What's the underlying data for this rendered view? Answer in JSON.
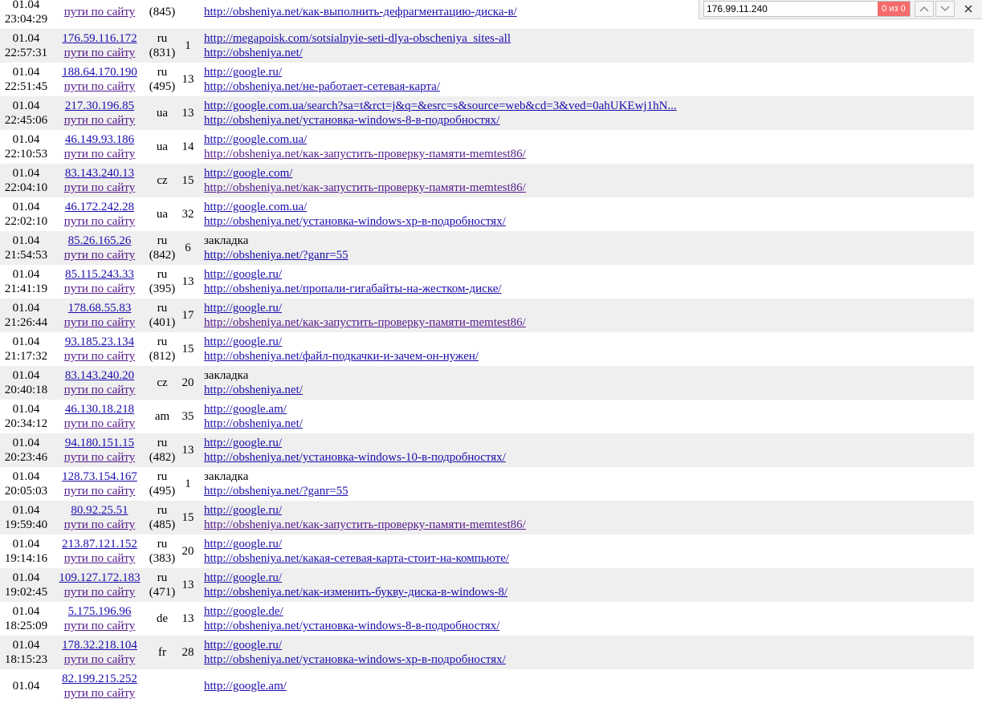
{
  "findbar": {
    "query": "176.99.11.240",
    "match_count": "0 из 0",
    "prev_icon": "chevron-up-icon",
    "next_icon": "chevron-down-icon",
    "close_icon": "close-icon",
    "count_color": "#f56b6b"
  },
  "path_label": "пути по сайту",
  "rows": [
    {
      "date": "01.04",
      "time": "23:04:29",
      "ip": "",
      "cc": "",
      "visits": "(845)",
      "n": "",
      "ref": "",
      "ref_link": false,
      "page": "http://obsheniya.net/как-выполнить-дефрагментацию-диска-в/"
    },
    {
      "date": "01.04",
      "time": "22:57:31",
      "ip": "176.59.116.172",
      "cc": "ru",
      "visits": "(831)",
      "n": "1",
      "ref": "http://megapoisk.com/sotsialnyie-seti-dlya-obscheniya_sites-all",
      "ref_link": true,
      "page": "http://obsheniya.net/"
    },
    {
      "date": "01.04",
      "time": "22:51:45",
      "ip": "188.64.170.190",
      "cc": "ru",
      "visits": "(495)",
      "n": "13",
      "ref": "http://google.ru/",
      "ref_link": true,
      "page": "http://obsheniya.net/не-работает-сетевая-карта/"
    },
    {
      "date": "01.04",
      "time": "22:45:06",
      "ip": "217.30.196.85",
      "cc": "ua",
      "visits": "",
      "n": "13",
      "ref": "http://google.com.ua/search?sa=t&rct=j&q=&esrc=s&source=web&cd=3&ved=0ahUKEwj1hN...",
      "ref_link": true,
      "page": "http://obsheniya.net/установка-windows-8-в-подробностях/"
    },
    {
      "date": "01.04",
      "time": "22:10:53",
      "ip": "46.149.93.186",
      "cc": "ua",
      "visits": "",
      "n": "14",
      "ref": "http://google.com.ua/",
      "ref_link": true,
      "page": "http://obsheniya.net/как-запустить-проверку-памяти-memtest86/"
    },
    {
      "date": "01.04",
      "time": "22:04:10",
      "ip": "83.143.240.13",
      "cc": "cz",
      "visits": "",
      "n": "15",
      "ref": "http://google.com/",
      "ref_link": true,
      "page": "http://obsheniya.net/как-запустить-проверку-памяти-memtest86/"
    },
    {
      "date": "01.04",
      "time": "22:02:10",
      "ip": "46.172.242.28",
      "cc": "ua",
      "visits": "",
      "n": "32",
      "ref": "http://google.com.ua/",
      "ref_link": true,
      "page": "http://obsheniya.net/установка-windows-xp-в-подробностях/"
    },
    {
      "date": "01.04",
      "time": "21:54:53",
      "ip": "85.26.165.26",
      "cc": "ru",
      "visits": "(842)",
      "n": "6",
      "ref": "закладка",
      "ref_link": false,
      "page": "http://obsheniya.net/?ganr=55"
    },
    {
      "date": "01.04",
      "time": "21:41:19",
      "ip": "85.115.243.33",
      "cc": "ru",
      "visits": "(395)",
      "n": "13",
      "ref": "http://google.ru/",
      "ref_link": true,
      "page": "http://obsheniya.net/пропали-гигабайты-на-жестком-диске/"
    },
    {
      "date": "01.04",
      "time": "21:26:44",
      "ip": "178.68.55.83",
      "cc": "ru",
      "visits": "(401)",
      "n": "17",
      "ref": "http://google.ru/",
      "ref_link": true,
      "page": "http://obsheniya.net/как-запустить-проверку-памяти-memtest86/"
    },
    {
      "date": "01.04",
      "time": "21:17:32",
      "ip": "93.185.23.134",
      "cc": "ru",
      "visits": "(812)",
      "n": "15",
      "ref": "http://google.ru/",
      "ref_link": true,
      "page": "http://obsheniya.net/файл-подкачки-и-зачем-он-нужен/"
    },
    {
      "date": "01.04",
      "time": "20:40:18",
      "ip": "83.143.240.20",
      "cc": "cz",
      "visits": "",
      "n": "20",
      "ref": "закладка",
      "ref_link": false,
      "page": "http://obsheniya.net/"
    },
    {
      "date": "01.04",
      "time": "20:34:12",
      "ip": "46.130.18.218",
      "cc": "am",
      "visits": "",
      "n": "35",
      "ref": "http://google.am/",
      "ref_link": true,
      "page": "http://obsheniya.net/"
    },
    {
      "date": "01.04",
      "time": "20:23:46",
      "ip": "94.180.151.15",
      "cc": "ru",
      "visits": "(482)",
      "n": "13",
      "ref": "http://google.ru/",
      "ref_link": true,
      "page": "http://obsheniya.net/установка-windows-10-в-подробностях/"
    },
    {
      "date": "01.04",
      "time": "20:05:03",
      "ip": "128.73.154.167",
      "cc": "ru",
      "visits": "(495)",
      "n": "1",
      "ref": "закладка",
      "ref_link": false,
      "page": "http://obsheniya.net/?ganr=55"
    },
    {
      "date": "01.04",
      "time": "19:59:40",
      "ip": "80.92.25.51",
      "cc": "ru",
      "visits": "(485)",
      "n": "15",
      "ref": "http://google.ru/",
      "ref_link": true,
      "page": "http://obsheniya.net/как-запустить-проверку-памяти-memtest86/"
    },
    {
      "date": "01.04",
      "time": "19:14:16",
      "ip": "213.87.121.152",
      "cc": "ru",
      "visits": "(383)",
      "n": "20",
      "ref": "http://google.ru/",
      "ref_link": true,
      "page": "http://obsheniya.net/какая-сетевая-карта-стоит-на-компьюте/"
    },
    {
      "date": "01.04",
      "time": "19:02:45",
      "ip": "109.127.172.183",
      "cc": "ru",
      "visits": "(471)",
      "n": "13",
      "ref": "http://google.ru/",
      "ref_link": true,
      "page": "http://obsheniya.net/как-изменить-букву-диска-в-windows-8/"
    },
    {
      "date": "01.04",
      "time": "18:25:09",
      "ip": "5.175.196.96",
      "cc": "de",
      "visits": "",
      "n": "13",
      "ref": "http://google.de/",
      "ref_link": true,
      "page": "http://obsheniya.net/установка-windows-8-в-подробностях/"
    },
    {
      "date": "01.04",
      "time": "18:15:23",
      "ip": "178.32.218.104",
      "cc": "fr",
      "visits": "",
      "n": "28",
      "ref": "http://google.ru/",
      "ref_link": true,
      "page": "http://obsheniya.net/установка-windows-xp-в-подробностях/"
    },
    {
      "date": "01.04",
      "time": "",
      "ip": "82.199.215.252",
      "cc": "",
      "visits": "",
      "n": "",
      "ref": "http://google.am/",
      "ref_link": true,
      "page": ""
    }
  ]
}
